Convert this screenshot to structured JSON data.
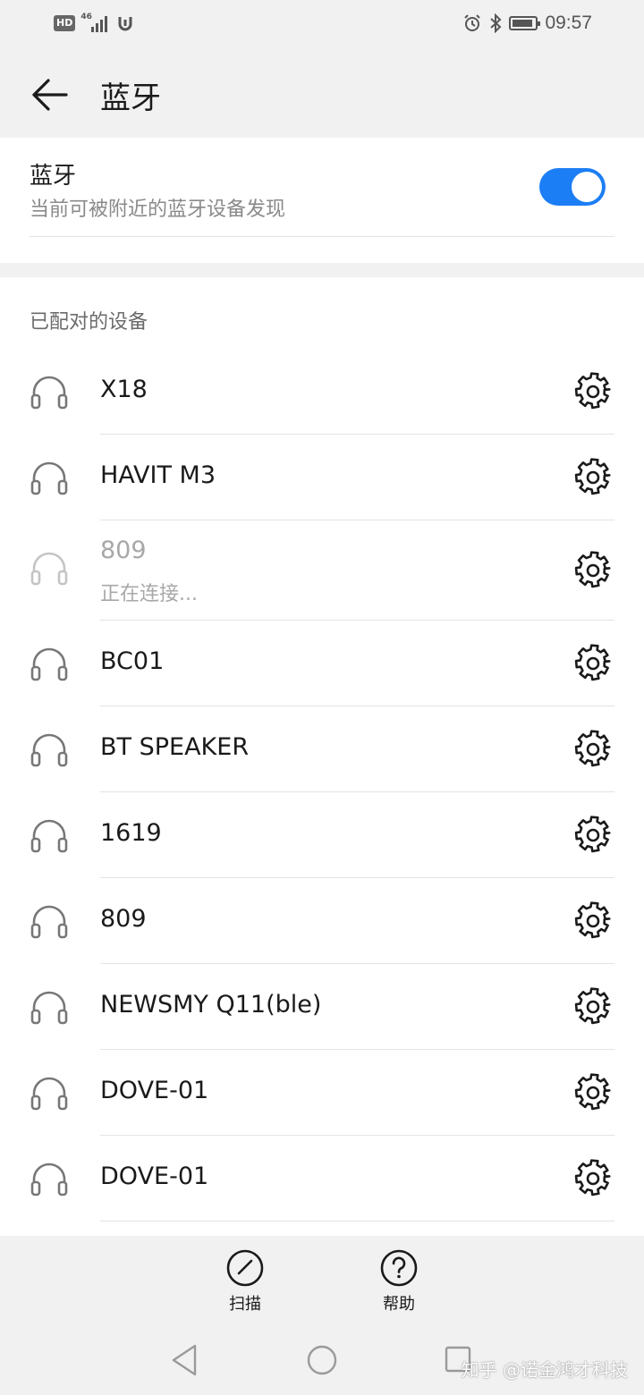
{
  "status_bar": {
    "hd_label": "HD",
    "network_label": "46",
    "time": "09:57",
    "battery_level": 0.9
  },
  "header": {
    "title": "蓝牙",
    "back_icon": "arrow-left-icon"
  },
  "bluetooth": {
    "label": "蓝牙",
    "subtitle": "当前可被附近的蓝牙设备发现",
    "enabled": true,
    "accent_color": "#1c7ef5"
  },
  "paired": {
    "section_title": "已配对的设备",
    "devices": [
      {
        "name": "X18"
      },
      {
        "name": "HAVIT M3"
      },
      {
        "name": "809",
        "status": "正在连接..."
      },
      {
        "name": "BC01"
      },
      {
        "name": "BT SPEAKER"
      },
      {
        "name": "1619"
      },
      {
        "name": "809"
      },
      {
        "name": "NEWSMY Q11(ble)"
      },
      {
        "name": "DOVE-01"
      },
      {
        "name": "DOVE-01"
      }
    ]
  },
  "bottom_bar": {
    "scan_label": "扫描",
    "help_label": "帮助"
  },
  "watermark": "知乎 @诺金鸿才科技"
}
